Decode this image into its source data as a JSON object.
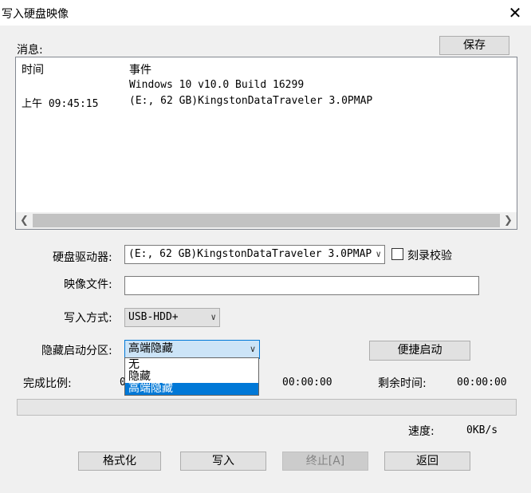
{
  "window": {
    "title": "写入硬盘映像",
    "close_glyph": "✕"
  },
  "log": {
    "label": "消息:",
    "save_label": "保存",
    "columns": [
      "时间",
      "事件"
    ],
    "rows": [
      {
        "time": "",
        "event": "Windows 10 v10.0 Build 16299"
      },
      {
        "time": "上午 09:45:15",
        "event": "(E:, 62 GB)KingstonDataTraveler 3.0PMAP"
      }
    ]
  },
  "form": {
    "drive_label": "硬盘驱动器:",
    "drive_value": "(E:, 62 GB)KingstonDataTraveler 3.0PMAP",
    "verify_label": "刻录校验",
    "verify_checked": false,
    "image_label": "映像文件:",
    "image_value": "",
    "write_mode_label": "写入方式:",
    "write_mode_value": "USB-HDD+",
    "hidden_part_label": "隐藏启动分区:",
    "hidden_part_value": "高端隐藏",
    "hidden_part_options": [
      "无",
      "隐藏",
      "高端隐藏"
    ],
    "hidden_part_selected_index": 2,
    "quick_boot_label": "便捷启动"
  },
  "status": {
    "progress_label": "完成比例:",
    "progress_value": "0",
    "elapsed": "00:00:00",
    "remaining_label": "剩余时间:",
    "remaining": "00:00:00",
    "speed_label": "速度:",
    "speed": "0KB/s",
    "progress_fraction": 0
  },
  "buttons": {
    "format": "格式化",
    "write": "写入",
    "abort": "终止[A]",
    "back": "返回"
  },
  "icons": {
    "scroll_left": "chevron-left-icon",
    "scroll_right": "chevron-right-icon",
    "dropdown": "chevron-down-icon"
  }
}
